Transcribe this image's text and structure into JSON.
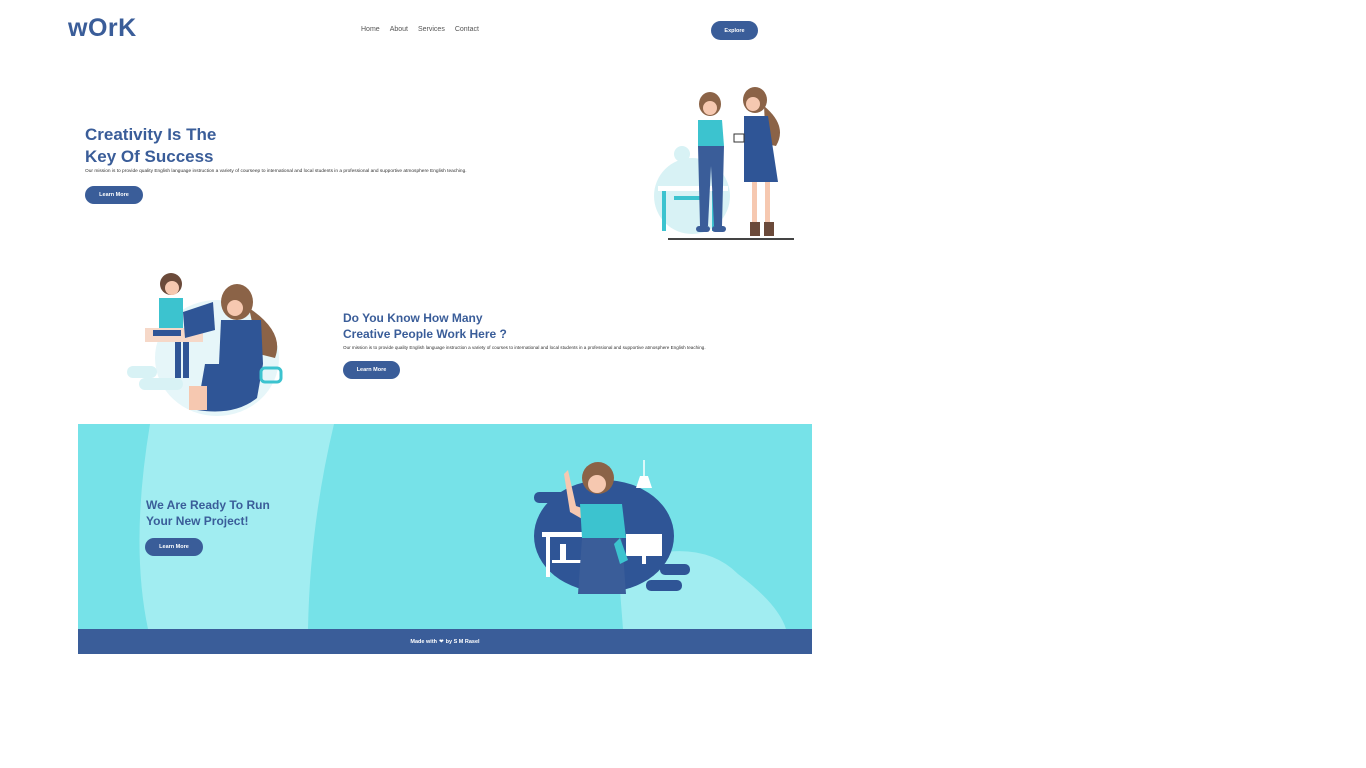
{
  "header": {
    "logo": "wOrK",
    "nav": [
      "Home",
      "About",
      "Services",
      "Contact"
    ],
    "explore_label": "Explore"
  },
  "hero": {
    "title_line1": "Creativity Is The",
    "title_line2": "Key Of Success",
    "description": "Our mission is to provide quality English language instruction a variety of courseep to international and local students in a professional and supportive atmosphere English teaching.",
    "button_label": "Learn More"
  },
  "section2": {
    "title_line1": "Do You Know How Many",
    "title_line2": "Creative People Work Here ?",
    "description": "Our mission is to provide quality English language instruction a variety of courses to international and local students in a professional and supportive atmosphere English teaching.",
    "button_label": "Learn More"
  },
  "section3": {
    "title_line1": "We Are Ready To Run",
    "title_line2": "Your New Project!",
    "button_label": "Learn More"
  },
  "footer": {
    "made_with": "Made with",
    "heart": "❤",
    "by": "by S M Rasel"
  },
  "colors": {
    "brand": "#3a5d99",
    "banner": "#76e2e8",
    "accent": "#3cc3cf"
  }
}
